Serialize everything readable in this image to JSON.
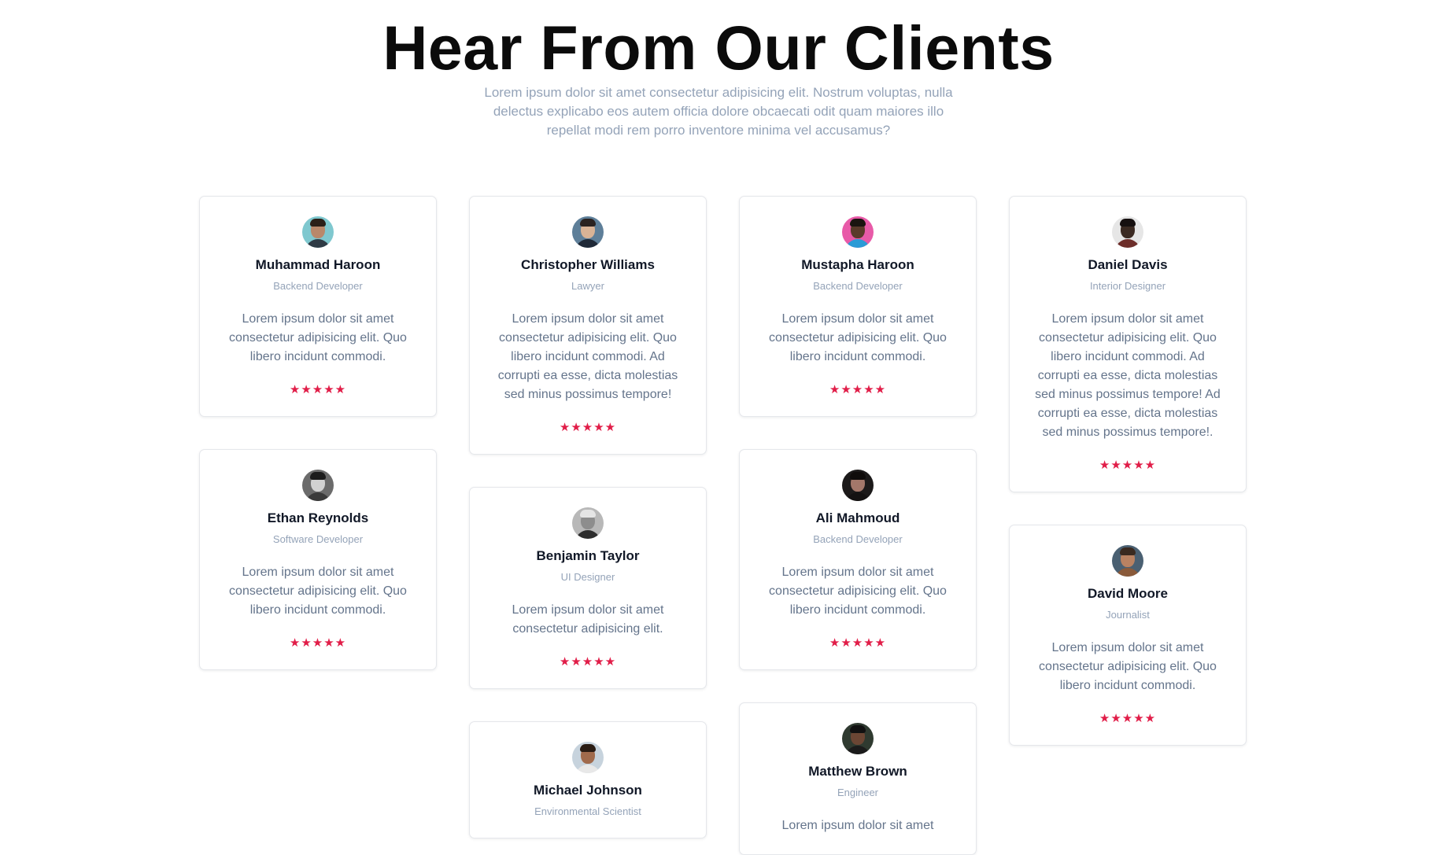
{
  "header": {
    "title": "Hear From Our Clients",
    "subtitle": "Lorem ipsum dolor sit amet consectetur adipisicing elit. Nostrum voluptas, nulla delectus explicabo eos autem officia dolore obcaecati odit quam maiores illo repellat modi rem porro inventore minima vel accusamus?"
  },
  "colors": {
    "star": "#e11d48",
    "name": "#111827",
    "role": "#94a3b8",
    "quote": "#64748b"
  },
  "columns": [
    {
      "cards": [
        {
          "name": "Muhammad Haroon",
          "role": "Backend Developer",
          "quote": "Lorem ipsum dolor sit amet consectetur adipisicing elit. Quo libero incidunt commodi.",
          "rating": "★★★★★",
          "avatar": {
            "bg": "#7fc8cf",
            "skin": "#b9886a",
            "hair": "#2b2018",
            "shirt": "#2f3b45"
          }
        },
        {
          "name": "Ethan Reynolds",
          "role": "Software Developer",
          "quote": "Lorem ipsum dolor sit amet consectetur adipisicing elit. Quo libero incidunt commodi.",
          "rating": "★★★★★",
          "avatar": {
            "bg": "#6b6b6b",
            "skin": "#d2d2d2",
            "hair": "#1c1c1c",
            "shirt": "#3a3a3a"
          }
        }
      ]
    },
    {
      "cards": [
        {
          "name": "Christopher Williams",
          "role": "Lawyer",
          "quote": "Lorem ipsum dolor sit amet consectetur adipisicing elit. Quo libero incidunt commodi. Ad corrupti ea esse, dicta molestias sed minus possimus tempore!",
          "rating": "★★★★★",
          "avatar": {
            "bg": "#5e7f99",
            "skin": "#d9b396",
            "hair": "#2a2220",
            "shirt": "#1f2937"
          }
        },
        {
          "name": "Benjamin Taylor",
          "role": "UI Designer",
          "quote": "Lorem ipsum dolor sit amet consectetur adipisicing elit.",
          "rating": "★★★★★",
          "avatar": {
            "bg": "#b8b8b8",
            "skin": "#8d8d8d",
            "hair": "#e5e5e5",
            "shirt": "#2d2d2d"
          }
        },
        {
          "name": "Michael Johnson",
          "role": "Environmental Scientist",
          "quote": "",
          "rating": "",
          "avatar": {
            "bg": "#c7d3dd",
            "skin": "#a06a4c",
            "hair": "#2a1c14",
            "shirt": "#e8e8e8"
          }
        }
      ]
    },
    {
      "cards": [
        {
          "name": "Mustapha Haroon",
          "role": "Backend Developer",
          "quote": "Lorem ipsum dolor sit amet consectetur adipisicing elit. Quo libero incidunt commodi.",
          "rating": "★★★★★",
          "avatar": {
            "bg": "#e85aa8",
            "skin": "#5a3a2a",
            "hair": "#1a1410",
            "shirt": "#2b9bd6"
          }
        },
        {
          "name": "Ali Mahmoud",
          "role": "Backend Developer",
          "quote": "Lorem ipsum dolor sit amet consectetur adipisicing elit. Quo libero incidunt commodi.",
          "rating": "★★★★★",
          "avatar": {
            "bg": "#1c1a1a",
            "skin": "#a3776a",
            "hair": "#0f0c0b",
            "shirt": "#141212"
          }
        },
        {
          "name": "Matthew Brown",
          "role": "Engineer",
          "quote": "Lorem ipsum dolor sit amet",
          "rating": "",
          "avatar": {
            "bg": "#2f3a30",
            "skin": "#6b4634",
            "hair": "#111111",
            "shirt": "#1b1b1b"
          }
        }
      ]
    },
    {
      "cards": [
        {
          "name": "Daniel Davis",
          "role": "Interior Designer",
          "quote": "Lorem ipsum dolor sit amet consectetur adipisicing elit. Quo libero incidunt commodi. Ad corrupti ea esse, dicta molestias sed minus possimus tempore! Ad corrupti ea esse, dicta molestias sed minus possimus tempore!.",
          "rating": "★★★★★",
          "avatar": {
            "bg": "#e6e6e6",
            "skin": "#3b2a22",
            "hair": "#161010",
            "shirt": "#6d2e2a"
          }
        },
        {
          "name": "David Moore",
          "role": "Journalist",
          "quote": "Lorem ipsum dolor sit amet consectetur adipisicing elit. Quo libero incidunt commodi.",
          "rating": "★★★★★",
          "avatar": {
            "bg": "#4a6072",
            "skin": "#b98262",
            "hair": "#3a2a20",
            "shirt": "#8a5a3a"
          }
        }
      ]
    }
  ]
}
